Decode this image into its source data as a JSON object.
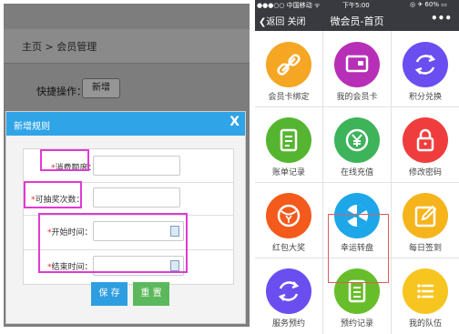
{
  "left": {
    "breadcrumb": "主页 > 会员管理",
    "quick_label": "快捷操作：",
    "quick_button": "新增",
    "dialog": {
      "title": "新增规则",
      "close": "X",
      "fields": [
        {
          "label": "消费额度："
        },
        {
          "label": "可抽奖次数："
        },
        {
          "label": "开始时间："
        },
        {
          "label": "结束时间："
        }
      ],
      "required_mark": "*",
      "save": "保 存",
      "reset": "重 置"
    }
  },
  "phone": {
    "status": {
      "carrier": "●●●○○ 中国移动 ᯤ",
      "time": "下午5:00",
      "battery": "◎ ✈ 60% ▭"
    },
    "nav": {
      "back": "❮返回  关闭",
      "title": "微会员-首页",
      "more": "•••"
    },
    "tiles": [
      {
        "label": "会员卡绑定",
        "color": "#f5a623",
        "icon": "link-icon"
      },
      {
        "label": "我的会员卡",
        "color": "#b72fb7",
        "icon": "card-icon"
      },
      {
        "label": "积分兑换",
        "color": "#6a4ef0",
        "icon": "exchange-icon"
      },
      {
        "label": "账单记录",
        "color": "#55b531",
        "icon": "bill-icon"
      },
      {
        "label": "在线充值",
        "color": "#3db35a",
        "icon": "yen-icon"
      },
      {
        "label": "修改密码",
        "color": "#ef3d3d",
        "icon": "lock-icon"
      },
      {
        "label": "红包大奖",
        "color": "#f35a1b",
        "icon": "redpacket-icon"
      },
      {
        "label": "幸运转盘",
        "color": "#1ea7e8",
        "icon": "wheel-icon"
      },
      {
        "label": "每日签到",
        "color": "#f6b41c",
        "icon": "edit-icon"
      },
      {
        "label": "服务预约",
        "color": "#6b4ef0",
        "icon": "refresh-icon"
      },
      {
        "label": "预约记录",
        "color": "#67be2a",
        "icon": "list-icon"
      },
      {
        "label": "我的队伍",
        "color": "#f7c51f",
        "icon": "menu-icon"
      }
    ]
  }
}
